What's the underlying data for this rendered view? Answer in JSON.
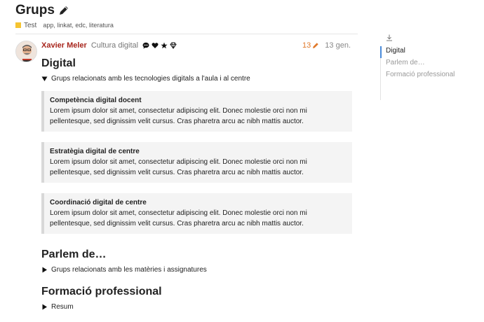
{
  "topic": {
    "title": "Grups",
    "category": "Test",
    "category_color": "#f5c431",
    "tags": "app, linkat, edc, literatura"
  },
  "post": {
    "username": "Xavier Meler",
    "user_title": "Cultura digital",
    "flair_icons": [
      "comment-icon",
      "heart-icon",
      "star-icon",
      "gem-icon"
    ],
    "edit_count": "13",
    "date": "13 gen.",
    "sections": {
      "digital": {
        "heading": "Digital",
        "summary": "Grups relacionats amb les tecnologies digitals a l'aula i al centre",
        "quotes": [
          {
            "title": "Competència digital docent",
            "text": "Lorem ipsum dolor sit amet, consectetur adipiscing elit. Donec molestie orci non mi pellentesque, sed dignissim velit cursus. Cras pharetra arcu ac nibh mattis auctor."
          },
          {
            "title": "Estratègia digital de centre",
            "text": "Lorem ipsum dolor sit amet, consectetur adipiscing elit. Donec molestie orci non mi pellentesque, sed dignissim velit cursus. Cras pharetra arcu ac nibh mattis auctor."
          },
          {
            "title": "Coordinació digital de centre",
            "text": "Lorem ipsum dolor sit amet, consectetur adipiscing elit. Donec molestie orci non mi pellentesque, sed dignissim velit cursus. Cras pharetra arcu ac nibh mattis auctor."
          }
        ]
      },
      "parlem": {
        "heading": "Parlem de…",
        "summary": "Grups relacionats amb les matèries i assignatures"
      },
      "formacio": {
        "heading": "Formació professional",
        "summary": "Resum"
      }
    }
  },
  "toc": {
    "items": [
      "Digital",
      "Parlem de…",
      "Formació professional"
    ],
    "active_color": "#4a8ad9"
  }
}
